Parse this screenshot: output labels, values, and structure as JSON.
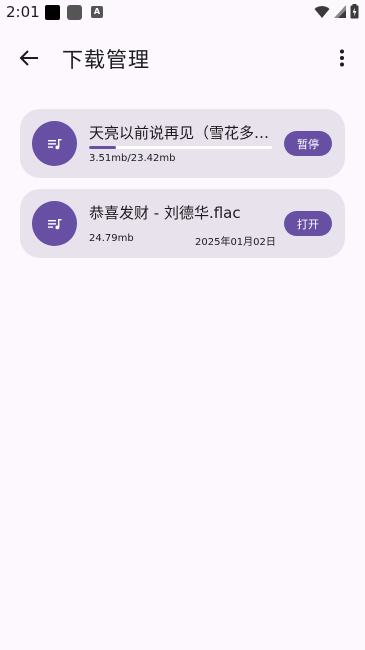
{
  "status_bar": {
    "time": "2:01"
  },
  "header": {
    "title": "下载管理"
  },
  "downloads": [
    {
      "name": "天亮以前说再见（雪花多舍...",
      "progress": 0.15,
      "size": "3.51mb/23.42mb",
      "date": "",
      "action_label": "暂停"
    },
    {
      "name": "恭喜发财 - 刘德华.flac",
      "size": "24.79mb",
      "date": "2025年01月02日",
      "action_label": "打开"
    }
  ],
  "colors": {
    "accent": "#6750A4",
    "card_bg": "#E8E2EC",
    "page_bg": "#FCF8FE"
  },
  "icons": {
    "back": "arrow-back-icon",
    "more": "more-vert-icon",
    "file": "music-list-icon",
    "wifi": "wifi-icon",
    "signal": "signal-icon",
    "battery": "battery-charging-icon"
  }
}
